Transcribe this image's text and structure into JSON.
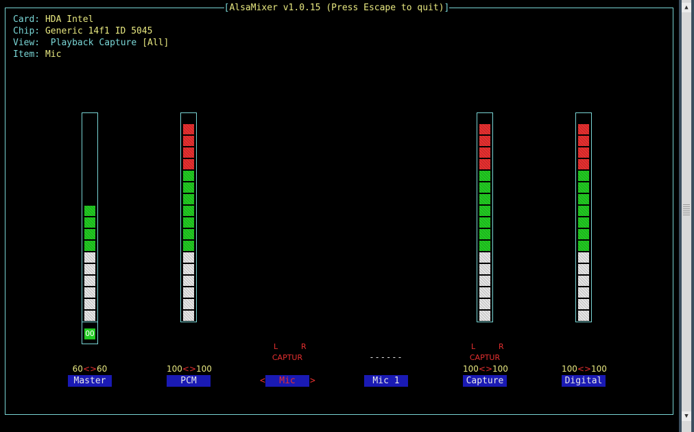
{
  "title": "AlsaMixer v1.0.15 (Press Escape to quit)",
  "info": {
    "card_label": "Card:",
    "card_value": "HDA Intel",
    "chip_label": "Chip:",
    "chip_value": "Generic 14f1 ID 5045",
    "view_label": "View:",
    "view_playback": "Playback",
    "view_capture": "Capture",
    "view_all": "[All]",
    "item_label": "Item:",
    "item_value": "Mic"
  },
  "controls": [
    {
      "name": "Master",
      "vol_left": "60",
      "arrows": "<>",
      "vol_right": "60",
      "level_percent": 60,
      "mute": "OO"
    },
    {
      "name": "PCM",
      "vol_left": "100",
      "arrows": "<>",
      "vol_right": "100",
      "level_percent": 100
    },
    {
      "name": "Mic",
      "left_label": "L",
      "right_label": "R",
      "capture": "CAPTUR",
      "sel_left": "<",
      "sel_right": ">"
    },
    {
      "name": "Mic 1",
      "dashes": "------"
    },
    {
      "name": "Capture",
      "vol_left": "100",
      "arrows": "<>",
      "vol_right": "100",
      "level_percent": 100,
      "left_label": "L",
      "right_label": "R",
      "capture": "CAPTUR"
    },
    {
      "name": "Digital",
      "vol_left": "100",
      "arrows": "<>",
      "vol_right": "100",
      "level_percent": 100
    }
  ],
  "colors": {
    "frame": "#7ad7d7",
    "text": "#e8e880",
    "red": "#e83030",
    "green": "#22cc22",
    "name_bg": "#1a1ab4"
  }
}
